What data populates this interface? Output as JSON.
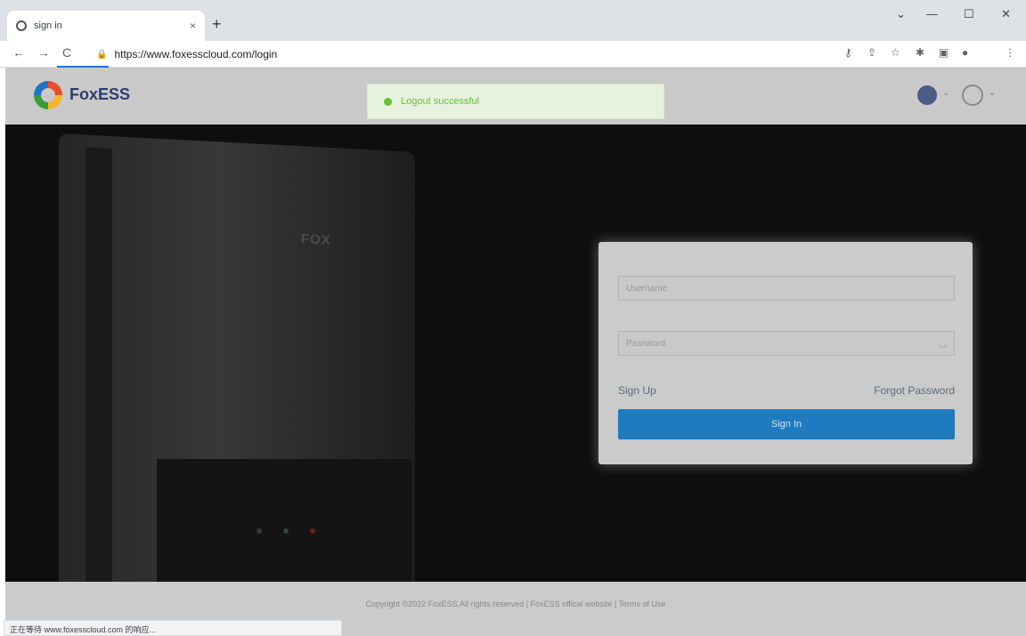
{
  "browser": {
    "tab_title": "sign in",
    "tab_close": "×",
    "new_tab": "+",
    "url": "https://www.foxesscloud.com/login",
    "window_controls": {
      "menu": "⌄",
      "minimize": "—",
      "maximize": "☐",
      "close": "✕"
    },
    "nav": {
      "back": "←",
      "forward": "→",
      "reload": "C"
    },
    "toolbar_icons": {
      "key": "⚷",
      "share": "⇪",
      "star": "☆",
      "extensions": "✱",
      "sidebar": "▣",
      "profile": "●",
      "menu": "⋮"
    },
    "status_text": "正在等待 www.foxesscloud.com 的响应..."
  },
  "header": {
    "logo_text": "FoxESS",
    "toast_message": "Logout successful",
    "chevron": "⌄"
  },
  "hero": {
    "device_logo": "FOX"
  },
  "login": {
    "username_placeholder": "Username",
    "password_placeholder": "Password",
    "password_eye": "◡",
    "sign_up": "Sign Up",
    "forgot_password": "Forgot Password",
    "sign_in": "Sign In"
  },
  "footer": {
    "copyright": "Copyright ©2022 FoxESS,All rights reserved  |  FoxESS offical website  |  Terms of Use"
  },
  "colors": {
    "brand_blue": "#1e7bbf",
    "success_green": "#67c23a",
    "logo_navy": "#2d3e6e"
  }
}
